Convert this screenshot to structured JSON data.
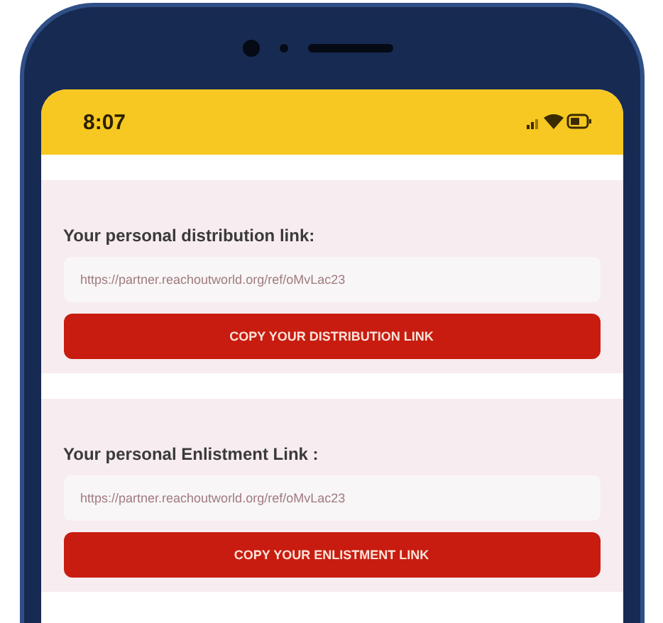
{
  "status_bar": {
    "time": "8:07"
  },
  "sections": [
    {
      "label": "Your personal distribution link:",
      "link": "https://partner.reachoutworld.org/ref/oMvLac23",
      "button": "COPY YOUR DISTRIBUTION LINK"
    },
    {
      "label": "Your personal Enlistment Link :",
      "link": "https://partner.reachoutworld.org/ref/oMvLac23",
      "button": "COPY YOUR ENLISTMENT LINK"
    }
  ]
}
